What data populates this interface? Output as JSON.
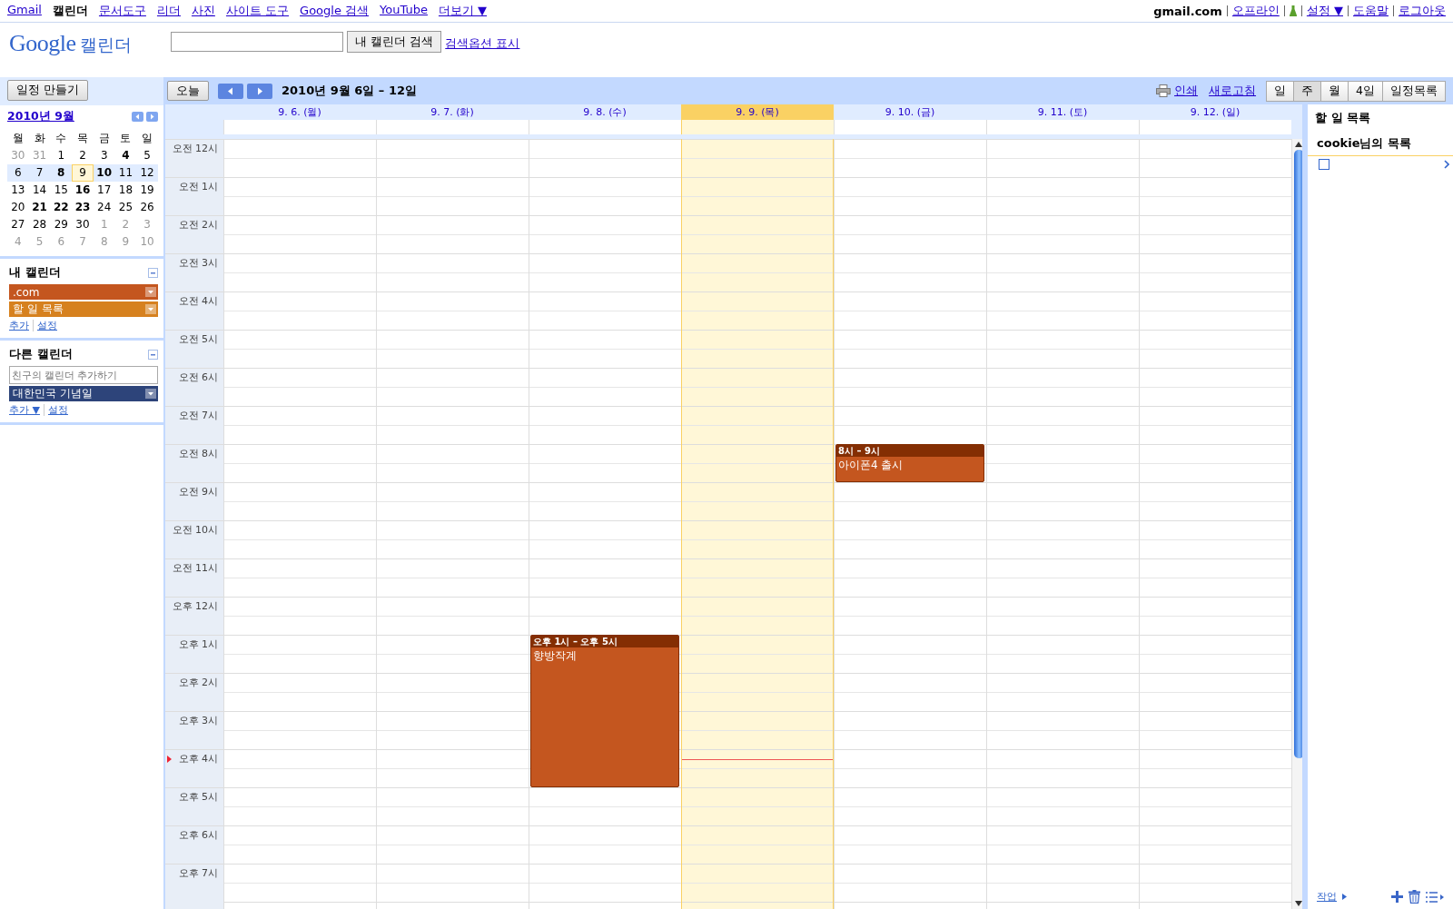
{
  "top_nav": {
    "links": [
      {
        "label": "Gmail",
        "selected": false
      },
      {
        "label": "캘린더",
        "selected": true
      },
      {
        "label": "문서도구",
        "selected": false
      },
      {
        "label": "리더",
        "selected": false
      },
      {
        "label": "사진",
        "selected": false
      },
      {
        "label": "사이트 도구",
        "selected": false
      },
      {
        "label": "Google 검색",
        "selected": false
      },
      {
        "label": "YouTube",
        "selected": false
      },
      {
        "label": "더보기 ▼",
        "selected": false
      }
    ],
    "account": "gmail.com",
    "account_links": [
      {
        "label": "오프라인",
        "kind": "link"
      },
      {
        "kind": "labs"
      },
      {
        "label": "설정 ▼",
        "kind": "link"
      },
      {
        "label": "도움말",
        "kind": "link"
      },
      {
        "label": "로그아웃",
        "kind": "link"
      }
    ]
  },
  "header": {
    "logo": "Google",
    "product": "캘린더",
    "search_button": "내 캘린더 검색",
    "search_options": "검색옵션 표시"
  },
  "sidebar": {
    "create_button": "일정 만들기",
    "mini_calendar": {
      "title": "2010년 9월",
      "weekdays": [
        "월",
        "화",
        "수",
        "목",
        "금",
        "토",
        "일"
      ],
      "weeks": [
        {
          "selected": false,
          "days": [
            {
              "label": "30",
              "other_month": true,
              "bold": false,
              "today": false
            },
            {
              "label": "31",
              "other_month": true,
              "bold": false,
              "today": false
            },
            {
              "label": "1",
              "other_month": false,
              "bold": false,
              "today": false
            },
            {
              "label": "2",
              "other_month": false,
              "bold": false,
              "today": false
            },
            {
              "label": "3",
              "other_month": false,
              "bold": false,
              "today": false
            },
            {
              "label": "4",
              "other_month": false,
              "bold": true,
              "today": false
            },
            {
              "label": "5",
              "other_month": false,
              "bold": false,
              "today": false
            }
          ]
        },
        {
          "selected": true,
          "days": [
            {
              "label": "6",
              "other_month": false,
              "bold": false,
              "today": false
            },
            {
              "label": "7",
              "other_month": false,
              "bold": false,
              "today": false
            },
            {
              "label": "8",
              "other_month": false,
              "bold": true,
              "today": false
            },
            {
              "label": "9",
              "other_month": false,
              "bold": false,
              "today": true
            },
            {
              "label": "10",
              "other_month": false,
              "bold": true,
              "today": false
            },
            {
              "label": "11",
              "other_month": false,
              "bold": false,
              "today": false
            },
            {
              "label": "12",
              "other_month": false,
              "bold": false,
              "today": false
            }
          ]
        },
        {
          "selected": false,
          "days": [
            {
              "label": "13",
              "other_month": false,
              "bold": false,
              "today": false
            },
            {
              "label": "14",
              "other_month": false,
              "bold": false,
              "today": false
            },
            {
              "label": "15",
              "other_month": false,
              "bold": false,
              "today": false
            },
            {
              "label": "16",
              "other_month": false,
              "bold": true,
              "today": false
            },
            {
              "label": "17",
              "other_month": false,
              "bold": false,
              "today": false
            },
            {
              "label": "18",
              "other_month": false,
              "bold": false,
              "today": false
            },
            {
              "label": "19",
              "other_month": false,
              "bold": false,
              "today": false
            }
          ]
        },
        {
          "selected": false,
          "days": [
            {
              "label": "20",
              "other_month": false,
              "bold": false,
              "today": false
            },
            {
              "label": "21",
              "other_month": false,
              "bold": true,
              "today": false
            },
            {
              "label": "22",
              "other_month": false,
              "bold": true,
              "today": false
            },
            {
              "label": "23",
              "other_month": false,
              "bold": true,
              "today": false
            },
            {
              "label": "24",
              "other_month": false,
              "bold": false,
              "today": false
            },
            {
              "label": "25",
              "other_month": false,
              "bold": false,
              "today": false
            },
            {
              "label": "26",
              "other_month": false,
              "bold": false,
              "today": false
            }
          ]
        },
        {
          "selected": false,
          "days": [
            {
              "label": "27",
              "other_month": false,
              "bold": false,
              "today": false
            },
            {
              "label": "28",
              "other_month": false,
              "bold": false,
              "today": false
            },
            {
              "label": "29",
              "other_month": false,
              "bold": false,
              "today": false
            },
            {
              "label": "30",
              "other_month": false,
              "bold": false,
              "today": false
            },
            {
              "label": "1",
              "other_month": true,
              "bold": false,
              "today": false
            },
            {
              "label": "2",
              "other_month": true,
              "bold": false,
              "today": false
            },
            {
              "label": "3",
              "other_month": true,
              "bold": false,
              "today": false
            }
          ]
        },
        {
          "selected": false,
          "days": [
            {
              "label": "4",
              "other_month": true,
              "bold": false,
              "today": false
            },
            {
              "label": "5",
              "other_month": true,
              "bold": false,
              "today": false
            },
            {
              "label": "6",
              "other_month": true,
              "bold": false,
              "today": false
            },
            {
              "label": "7",
              "other_month": true,
              "bold": false,
              "today": false
            },
            {
              "label": "8",
              "other_month": true,
              "bold": false,
              "today": false
            },
            {
              "label": "9",
              "other_month": true,
              "bold": false,
              "today": false
            },
            {
              "label": "10",
              "other_month": true,
              "bold": false,
              "today": false
            }
          ]
        }
      ]
    },
    "my_calendars": {
      "title": "내 캘린더",
      "items": [
        {
          "label": ".com",
          "color": "#c4561f"
        },
        {
          "label": "할 일 목록",
          "color": "#d6811f"
        }
      ],
      "links": [
        "추가",
        "설정"
      ]
    },
    "other_calendars": {
      "title": "다른 캘린더",
      "placeholder": "친구의 캘린더 추가하기",
      "items": [
        {
          "label": "대한민국 기념일",
          "color": "#2d447a"
        }
      ],
      "links": [
        "추가 ▼",
        "설정"
      ]
    }
  },
  "toolbar": {
    "today_button": "오늘",
    "range": "2010년 9월 6일 – 12일",
    "print": "인쇄",
    "refresh": "새로고침",
    "views": [
      {
        "label": "일",
        "selected": false
      },
      {
        "label": "주",
        "selected": true
      },
      {
        "label": "월",
        "selected": false
      },
      {
        "label": "4일",
        "selected": false
      },
      {
        "label": "일정목록",
        "selected": false
      }
    ]
  },
  "week": {
    "hours": [
      {
        "label": "오전 12시",
        "now": false
      },
      {
        "label": "오전 1시",
        "now": false
      },
      {
        "label": "오전 2시",
        "now": false
      },
      {
        "label": "오전 3시",
        "now": false
      },
      {
        "label": "오전 4시",
        "now": false
      },
      {
        "label": "오전 5시",
        "now": false
      },
      {
        "label": "오전 6시",
        "now": false
      },
      {
        "label": "오전 7시",
        "now": false
      },
      {
        "label": "오전 8시",
        "now": false
      },
      {
        "label": "오전 9시",
        "now": false
      },
      {
        "label": "오전 10시",
        "now": false
      },
      {
        "label": "오전 11시",
        "now": false
      },
      {
        "label": "오후 12시",
        "now": false
      },
      {
        "label": "오후 1시",
        "now": false
      },
      {
        "label": "오후 2시",
        "now": false
      },
      {
        "label": "오후 3시",
        "now": false
      },
      {
        "label": "오후 4시",
        "now": true
      },
      {
        "label": "오후 5시",
        "now": false
      },
      {
        "label": "오후 6시",
        "now": false
      },
      {
        "label": "오후 7시",
        "now": false
      }
    ],
    "days": [
      {
        "label": "9. 6. (월)",
        "today": false
      },
      {
        "label": "9. 7. (화)",
        "today": false
      },
      {
        "label": "9. 8. (수)",
        "today": false,
        "slots": [
          {
            "kind": "free"
          },
          {
            "kind": "free"
          },
          {
            "kind": "free"
          },
          {
            "kind": "free"
          },
          {
            "kind": "free"
          },
          {
            "kind": "free"
          },
          {
            "kind": "free"
          },
          {
            "kind": "free"
          },
          {
            "kind": "free"
          },
          {
            "kind": "free"
          },
          {
            "kind": "free"
          },
          {
            "kind": "free"
          },
          {
            "kind": "free"
          },
          {
            "kind": "event",
            "time": "오후 1시 – 오후 5시",
            "title": "향방작계"
          },
          {
            "kind": "continued"
          },
          {
            "kind": "continued"
          },
          {
            "kind": "continued"
          }
        ]
      },
      {
        "label": "9. 9. (목)",
        "today": true
      },
      {
        "label": "9. 10. (금)",
        "today": false,
        "slots": [
          {
            "kind": "free"
          },
          {
            "kind": "free"
          },
          {
            "kind": "free"
          },
          {
            "kind": "free"
          },
          {
            "kind": "free"
          },
          {
            "kind": "free"
          },
          {
            "kind": "free"
          },
          {
            "kind": "free"
          },
          {
            "kind": "event",
            "time": "8시 – 9시",
            "title": "아이폰4 출시"
          }
        ]
      },
      {
        "label": "9. 11. (토)",
        "today": false
      },
      {
        "label": "9. 12. (일)",
        "today": false
      }
    ]
  },
  "tasks": {
    "title": "할 일 목록",
    "list_title": "cookie님의 목록",
    "items": [
      {
        "checked": false
      }
    ],
    "footer_link": "작업"
  }
}
